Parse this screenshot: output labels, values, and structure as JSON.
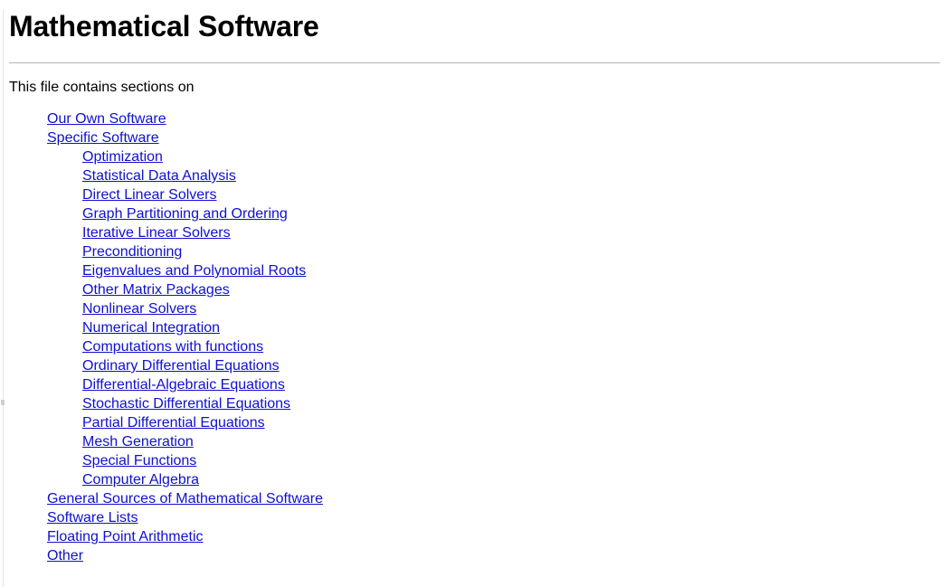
{
  "document": {
    "title": "Mathematical Software",
    "intro": "This file contains sections on",
    "link_color": "#1010d0",
    "rule_color": "#b4b4b4",
    "text_color": "#000000"
  },
  "toc": {
    "items": [
      {
        "label": "Our Own Software",
        "level": 1
      },
      {
        "label": "Specific Software",
        "level": 1
      },
      {
        "label": "Optimization",
        "level": 2
      },
      {
        "label": "Statistical Data Analysis",
        "level": 2
      },
      {
        "label": "Direct Linear Solvers",
        "level": 2
      },
      {
        "label": "Graph Partitioning and Ordering",
        "level": 2
      },
      {
        "label": "Iterative Linear Solvers",
        "level": 2
      },
      {
        "label": "Preconditioning",
        "level": 2
      },
      {
        "label": "Eigenvalues and Polynomial Roots",
        "level": 2
      },
      {
        "label": "Other Matrix Packages",
        "level": 2
      },
      {
        "label": "Nonlinear Solvers",
        "level": 2
      },
      {
        "label": "Numerical Integration",
        "level": 2
      },
      {
        "label": "Computations with functions",
        "level": 2
      },
      {
        "label": "Ordinary Differential Equations",
        "level": 2
      },
      {
        "label": "Differential-Algebraic Equations",
        "level": 2
      },
      {
        "label": "Stochastic Differential Equations",
        "level": 2
      },
      {
        "label": "Partial Differential Equations",
        "level": 2
      },
      {
        "label": "Mesh Generation",
        "level": 2
      },
      {
        "label": "Special Functions",
        "level": 2
      },
      {
        "label": "Computer Algebra",
        "level": 2
      },
      {
        "label": "General Sources of Mathematical Software",
        "level": 1
      },
      {
        "label": "Software Lists",
        "level": 1
      },
      {
        "label": "Floating Point Arithmetic",
        "level": 1
      },
      {
        "label": "Other",
        "level": 1
      }
    ]
  }
}
